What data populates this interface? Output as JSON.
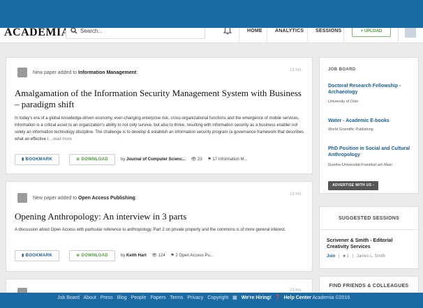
{
  "header": {
    "logo": "ACADEMIA",
    "search_placeholder": "Search...",
    "nav": [
      "HOME",
      "ANALYTICS",
      "SESSIONS"
    ],
    "upload_label": "+ UPLOAD"
  },
  "feed": [
    {
      "notice_prefix": "New paper added to ",
      "notice_target": "Information Management",
      "notice_suffix": ":",
      "time": "13 hrs",
      "title": "Amalgamation of the Information Security Management System with Business – paradigm shift",
      "excerpt": "In today's era of a global knowledge-driven economy, ever-changing enterprise risk, cross-organizational functions and the emergence of mobile services, information is a critical asset to an organization's ability to not only survive, but also to thrive, resulting with information security as a business enabler not solely an information technology discipline. The challenge is to develop & establish an information security program (a governance framework that describes what an effective i",
      "more": "...read more",
      "bookmark": "BOOKMARK",
      "download": "DOWNLOAD",
      "by": "by ",
      "author": "Journal of Computer Scienc...",
      "views": "23",
      "tags": "17",
      "tag_name": "Information M..."
    },
    {
      "notice_prefix": "New paper added to ",
      "notice_target": "Open Access Publishing",
      "notice_suffix": ":",
      "time": "13 hrs",
      "title": "Opening Anthropology: An interview in 3 parts",
      "excerpt": "A discussion about Open Access with particular reference to anthropology. Part 2 on private property and the commons is of more general interest.",
      "bookmark": "BOOKMARK",
      "download": "DOWNLOAD",
      "by": "by ",
      "author": "Keith Hart",
      "views": "124",
      "tags": "2",
      "tag_name": "Open Access Pu..."
    },
    {
      "time": "23 hrs"
    }
  ],
  "sidebar": {
    "job_board_title": "JOB BOARD",
    "jobs": [
      {
        "title": "Doctoral Research Fellowship - Archaeology",
        "org": "University of Oslo"
      },
      {
        "title": "Water - Academic E-books",
        "org": "World Scientific Publishing"
      },
      {
        "title": "PhD Position in Social and Cultural Anthropology",
        "org": "Goethe-Universität Frankfurt am Main"
      }
    ],
    "advertise_label": "ADVERTISE WITH US  ›",
    "suggested_title": "SUGGESTED SESSIONS",
    "session": {
      "title": "Scrivener & Smith - Editorial Creativity Services",
      "join": "Join",
      "count": "1",
      "person": "James L. Smith"
    },
    "friends_title": "FIND FRIENDS & COLLEAGUES"
  },
  "footer": {
    "links": [
      "Job Board",
      "About",
      "Press",
      "Blog",
      "People",
      "Papers",
      "Terms",
      "Privacy",
      "Copyright"
    ],
    "hiring": "We're Hiring!",
    "help": "Help Center",
    "copyright": "Academia ©2016"
  },
  "colors": {
    "brand_blue": "#1a6aa3",
    "link_blue": "#1a5f94",
    "download_green": "#4a9a37"
  }
}
